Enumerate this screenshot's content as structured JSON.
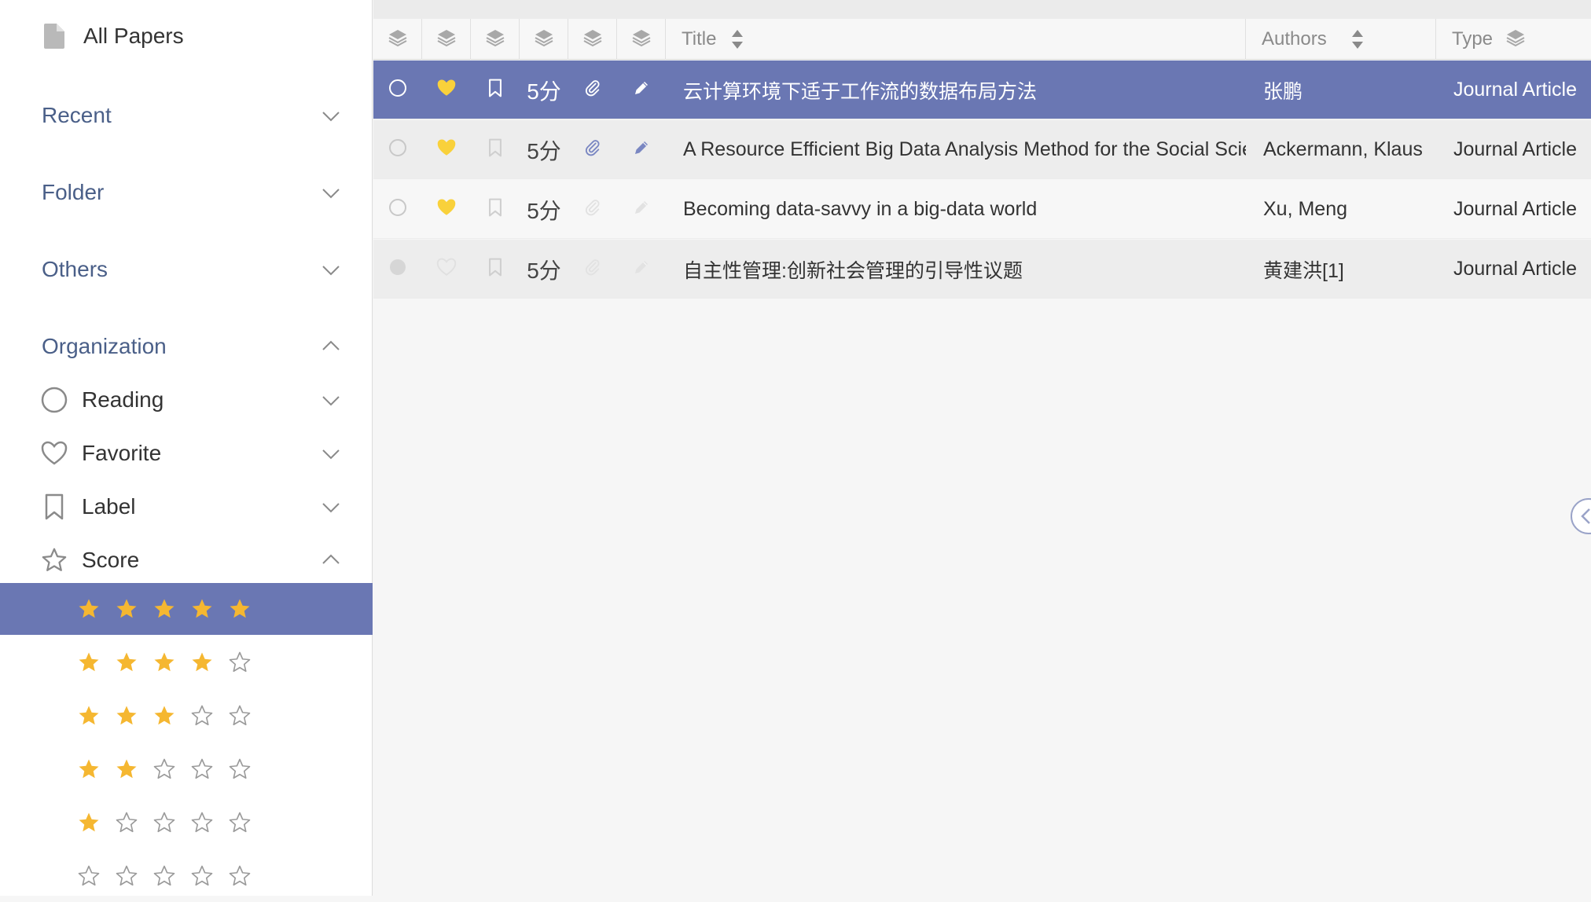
{
  "sidebar": {
    "all_papers": "All Papers",
    "sections": {
      "recent": "Recent",
      "folder": "Folder",
      "others": "Others",
      "organization": "Organization"
    },
    "organization_items": {
      "reading": "Reading",
      "favorite": "Favorite",
      "label": "Label",
      "score": "Score"
    },
    "score_filters": [
      {
        "stars": 5,
        "selected": true
      },
      {
        "stars": 4,
        "selected": false
      },
      {
        "stars": 3,
        "selected": false
      },
      {
        "stars": 2,
        "selected": false
      },
      {
        "stars": 1,
        "selected": false
      },
      {
        "stars": 0,
        "selected": false
      }
    ]
  },
  "table": {
    "headers": {
      "title": "Title",
      "authors": "Authors",
      "type": "Type"
    },
    "rows": [
      {
        "title": "云计算环境下适于工作流的数据布局方法",
        "authors": "张鹏",
        "type": "Journal Article",
        "score": "5分",
        "read": "unread",
        "favorite": true,
        "labeled": false,
        "has_attachment": true,
        "has_note": true,
        "selected": true
      },
      {
        "title": "A Resource Efficient Big Data Analysis Method for the Social Sciences: the case of global IP activity",
        "authors": "Ackermann, Klaus",
        "type": "Journal Article",
        "score": "5分",
        "read": "unread",
        "favorite": true,
        "labeled": false,
        "has_attachment": true,
        "has_note": true,
        "selected": false
      },
      {
        "title": "Becoming data-savvy in a big-data world",
        "authors": "Xu, Meng",
        "type": "Journal Article",
        "score": "5分",
        "read": "unread",
        "favorite": true,
        "labeled": false,
        "has_attachment": false,
        "has_note": false,
        "selected": false
      },
      {
        "title": "自主性管理:创新社会管理的引导性议题",
        "authors": "黄建洪[1]",
        "type": "Journal Article",
        "score": "5分",
        "read": "read",
        "favorite": false,
        "labeled": false,
        "has_attachment": false,
        "has_note": false,
        "selected": false
      }
    ]
  },
  "colors": {
    "accent": "#6a77b3",
    "star_filled": "#f5b731",
    "favorite": "#f9d13b",
    "section_text": "#4a5f88"
  }
}
